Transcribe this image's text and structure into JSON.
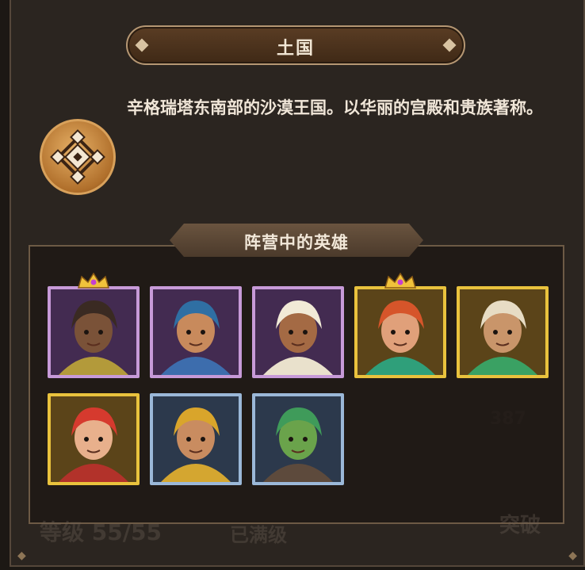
{
  "kingdom": {
    "title": "土国",
    "description": "辛格瑞塔东南部的沙漠王国。以华丽的宫殿和贵族著称。"
  },
  "heroes_section": {
    "header": "阵营中的英雄",
    "heroes": [
      {
        "rarity": "purple",
        "crown": true,
        "hair": "#3a2a22",
        "skin": "#7a5238",
        "outfit": "#b39a3a"
      },
      {
        "rarity": "purple",
        "crown": false,
        "hair": "#2f6fa3",
        "skin": "#c88a5c",
        "outfit": "#3d6dad"
      },
      {
        "rarity": "purple",
        "crown": false,
        "hair": "#f1ead7",
        "skin": "#a46a44",
        "outfit": "#e9e1cc"
      },
      {
        "rarity": "gold",
        "crown": true,
        "hair": "#d6552a",
        "skin": "#e0a07a",
        "outfit": "#2f9f7a"
      },
      {
        "rarity": "gold",
        "crown": false,
        "hair": "#e7dcc4",
        "skin": "#c9956a",
        "outfit": "#3aa163"
      },
      {
        "rarity": "gold",
        "crown": false,
        "hair": "#d63a2e",
        "skin": "#e8b08c",
        "outfit": "#b2322a"
      },
      {
        "rarity": "blue",
        "crown": false,
        "hair": "#d9a52b",
        "skin": "#c98c60",
        "outfit": "#d4a630"
      },
      {
        "rarity": "blue",
        "crown": false,
        "hair": "#3f9b5a",
        "skin": "#6aa34b",
        "outfit": "#5d4a3c"
      }
    ]
  },
  "background_text": {
    "level_label": "等级",
    "level_value": "55/55",
    "maxed": "已满级",
    "break": "突破",
    "count": "387"
  },
  "colors": {
    "purple_frame": "#c79ad8",
    "gold_frame": "#e9c23d",
    "blue_frame": "#9bb8d8",
    "panel_border": "#6d5a45",
    "title_border": "#b59773"
  }
}
